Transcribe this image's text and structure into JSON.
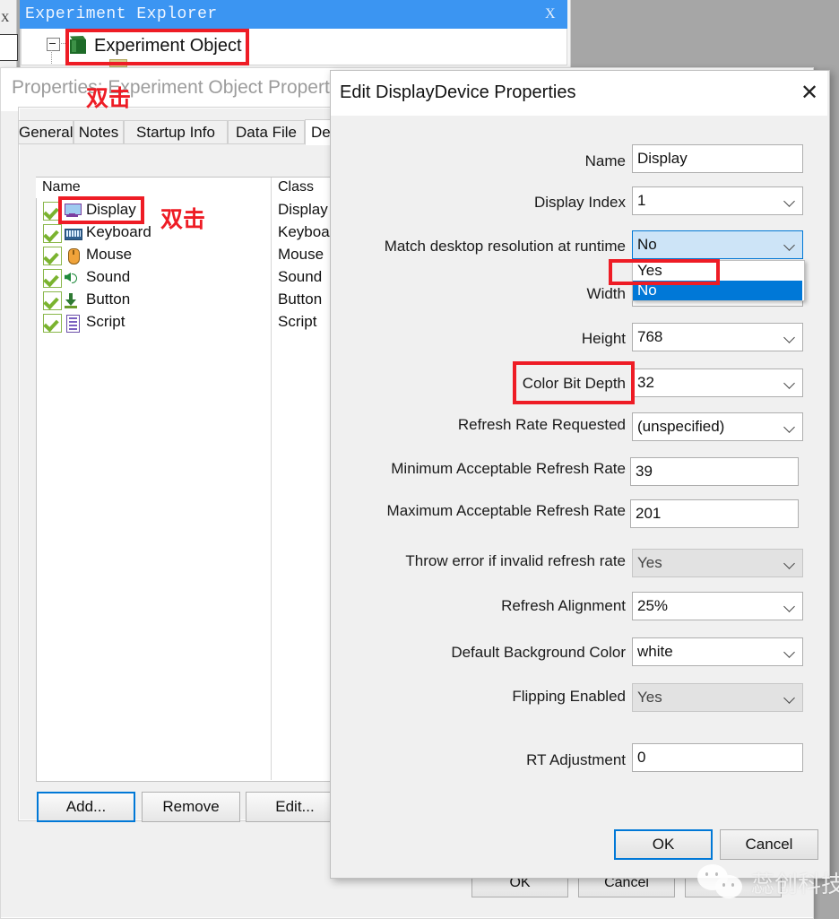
{
  "explorer": {
    "title": "Experiment Explorer",
    "close_label": "X",
    "node_label": "Experiment Object"
  },
  "properties_window": {
    "title": "Properties: Experiment Object Properties",
    "close_icon": "close-icon",
    "tabs": [
      {
        "label": "General",
        "active": false
      },
      {
        "label": "Notes",
        "active": false
      },
      {
        "label": "Startup Info",
        "active": false
      },
      {
        "label": "Data File",
        "active": false
      },
      {
        "label": "Devices",
        "active": true
      }
    ],
    "grid": {
      "columns": [
        "Name",
        "Class"
      ],
      "rows": [
        {
          "checked": true,
          "icon": "display-icon",
          "name": "Display",
          "class": "Display"
        },
        {
          "checked": true,
          "icon": "keyboard-icon",
          "name": "Keyboard",
          "class": "Keyboard"
        },
        {
          "checked": true,
          "icon": "mouse-icon",
          "name": "Mouse",
          "class": "Mouse"
        },
        {
          "checked": true,
          "icon": "sound-icon",
          "name": "Sound",
          "class": "Sound"
        },
        {
          "checked": true,
          "icon": "button-icon",
          "name": "Button",
          "class": "Button"
        },
        {
          "checked": true,
          "icon": "script-icon",
          "name": "Script",
          "class": "Script"
        }
      ]
    },
    "grid_buttons": [
      {
        "label": "Add...",
        "focused": true
      },
      {
        "label": "Remove",
        "focused": false
      },
      {
        "label": "Edit...",
        "focused": false
      }
    ],
    "footer_buttons": [
      {
        "label": "OK"
      },
      {
        "label": "Cancel"
      },
      {
        "label": ""
      }
    ]
  },
  "edit_dialog": {
    "title": "Edit DisplayDevice Properties",
    "close_icon": "close-icon",
    "fields": [
      {
        "label": "Name",
        "value": "Display",
        "type": "text",
        "disabled": false
      },
      {
        "label": "Display Index",
        "value": "1",
        "type": "combo",
        "disabled": false
      },
      {
        "label": "Match desktop resolution at runtime",
        "value": "No",
        "type": "combo",
        "disabled": false,
        "open": true
      },
      {
        "label": "Width",
        "value": "",
        "type": "combo",
        "disabled": false
      },
      {
        "label": "Height",
        "value": "768",
        "type": "combo",
        "disabled": false
      },
      {
        "label": "Color Bit Depth",
        "value": "32",
        "type": "combo",
        "disabled": false
      },
      {
        "label": "Refresh Rate Requested",
        "value": "(unspecified)",
        "type": "combo",
        "disabled": false
      },
      {
        "label": "Minimum Acceptable Refresh Rate",
        "value": "39",
        "type": "text",
        "disabled": false
      },
      {
        "label": "Maximum Acceptable Refresh Rate",
        "value": "201",
        "type": "text",
        "disabled": false
      },
      {
        "label": "Throw error if invalid refresh rate",
        "value": "Yes",
        "type": "combo",
        "disabled": true
      },
      {
        "label": "Refresh Alignment",
        "value": "25%",
        "type": "combo",
        "disabled": false
      },
      {
        "label": "Default Background Color",
        "value": "white",
        "type": "combo",
        "disabled": false
      },
      {
        "label": "Flipping Enabled",
        "value": "Yes",
        "type": "combo",
        "disabled": true
      },
      {
        "label": "RT Adjustment",
        "value": "0",
        "type": "text",
        "disabled": false
      }
    ],
    "dropdown_options": [
      {
        "label": "Yes",
        "selected": false
      },
      {
        "label": "No",
        "selected": true
      }
    ],
    "buttons": [
      {
        "label": "OK",
        "focused": true
      },
      {
        "label": "Cancel",
        "focused": false
      }
    ]
  },
  "annotations": {
    "double_click_top": "双击",
    "double_click_list": "双击",
    "accent_red": "#ee1c25"
  },
  "watermark": {
    "text": "蕊创科技",
    "icon": "wechat-icon"
  }
}
